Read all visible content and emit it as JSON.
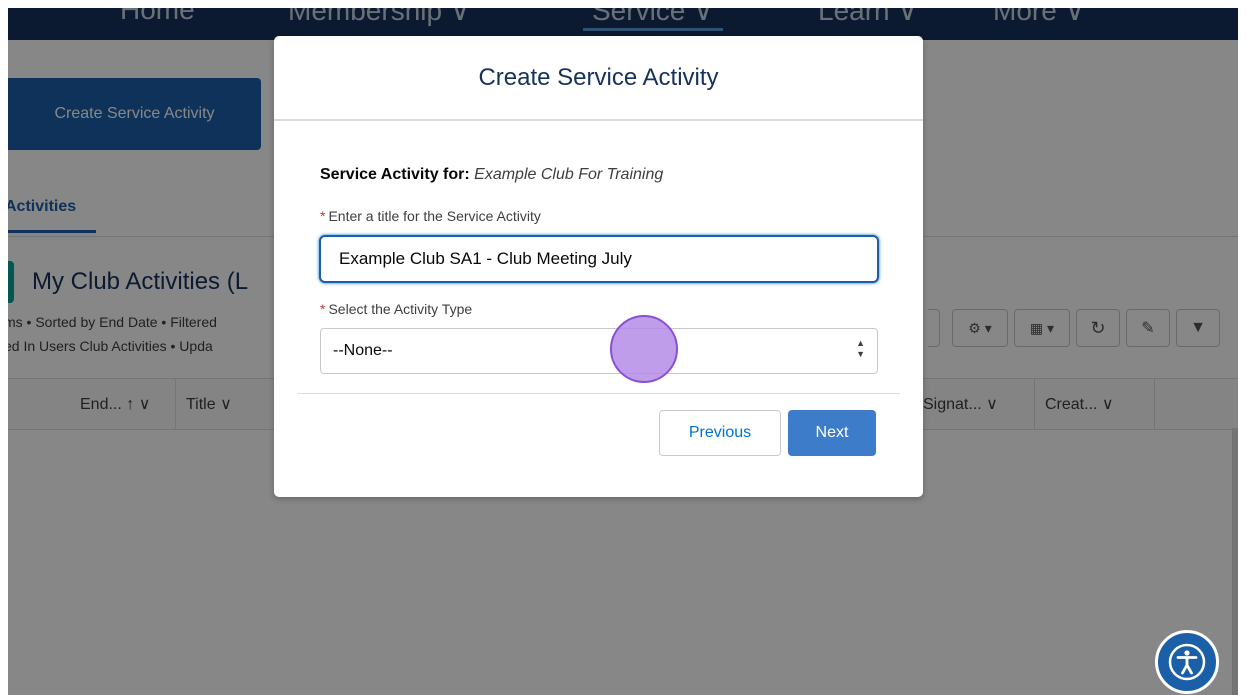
{
  "nav": {
    "items": [
      "Home",
      "Membership ∨",
      "Service ∨",
      "Learn ∨",
      "More ∨"
    ]
  },
  "page": {
    "create_button": "Create Service Activity",
    "tab_label": "Activities",
    "list_title": "My Club Activities (L",
    "list_meta_1": "ms • Sorted by End Date • Filtered",
    "list_meta_2": "ed In Users Club Activities • Upda",
    "columns": [
      "End... ↑ ∨",
      "Title ∨",
      "Signat... ∨",
      "Creat... ∨"
    ]
  },
  "modal": {
    "title": "Create Service Activity",
    "for_label": "Service Activity for:",
    "for_club": "Example Club For Training",
    "required_mark": "*",
    "title_label": "Enter a title for the Service Activity",
    "title_value": "Example Club SA1 - Club Meeting July",
    "type_label": "Select the Activity Type",
    "type_selected": "--None--",
    "previous_button": "Previous",
    "next_button": "Next"
  },
  "colors": {
    "brand": "#16325c",
    "accent": "#1b5fa8",
    "next": "#3d7cc9"
  }
}
